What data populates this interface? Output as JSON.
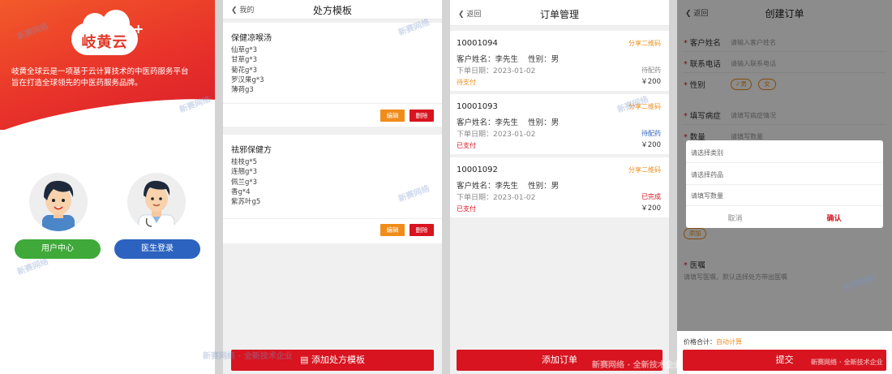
{
  "panel1": {
    "logo_text": "岐黄云",
    "logo_plus": "+",
    "desc_line1": "岐黄全球云是一项基于云计算技术的中医药服务平台",
    "desc_line2": "旨在打造全球领先的中医药服务品牌。",
    "user_center_label": "用户中心",
    "doctor_login_label": "医生登录",
    "colors": {
      "accent": "#e8322a",
      "green": "#3fa93a",
      "blue": "#2c63c0"
    }
  },
  "panel2": {
    "back_label": "我的",
    "title": "处方模板",
    "templates": [
      {
        "name": "保健凉喉汤",
        "herbs": [
          "仙草g*3",
          "甘草g*3",
          "菊花g*3",
          "罗汉果g*3",
          "薄荷g3"
        ],
        "edit": "编辑",
        "delete": "删除"
      },
      {
        "name": "祛邪保健方",
        "herbs": [
          "桂枝g*5",
          "连翘g*3",
          "佩兰g*3",
          "香g*4",
          "紫苏叶g5"
        ],
        "edit": "编辑",
        "delete": "删除"
      }
    ],
    "add_button": "添加处方模板"
  },
  "panel3": {
    "back_label": "返回",
    "title": "订单管理",
    "orders": [
      {
        "id": "10001094",
        "share": "分享二维码",
        "customer": "客户姓名：李先生",
        "gender": "性别：男",
        "date": "下单日期：2023-01-02",
        "status": "待配药",
        "paid": "待支付",
        "price": "￥200"
      },
      {
        "id": "10001093",
        "share": "分享二维码",
        "customer": "客户姓名：李先生",
        "gender": "性别：男",
        "date": "下单日期：2023-01-02",
        "status": "待配药",
        "paid": "已支付",
        "price": "￥200"
      },
      {
        "id": "10001092",
        "share": "分享二维码",
        "customer": "客户姓名：李先生",
        "gender": "性别：男",
        "date": "下单日期：2023-01-02",
        "status": "已完成",
        "paid": "已支付",
        "price": "￥200"
      }
    ],
    "add_button": "添加订单"
  },
  "panel4": {
    "back_label": "返回",
    "title": "创建订单",
    "fields": [
      {
        "label": "客户姓名",
        "placeholder": "请输入客户姓名"
      },
      {
        "label": "联系电话",
        "placeholder": "请输入联系电话"
      },
      {
        "label": "性别",
        "placeholder": ""
      },
      {
        "label": "填写病症",
        "placeholder": "请填写病症情况"
      },
      {
        "label": "数量",
        "placeholder": "请填写数量"
      }
    ],
    "gender_male": "男",
    "gender_female": "女",
    "add_tag": "添加",
    "advice_label": "医嘱",
    "advice_placeholder": "请填写医嘱，默认选择处方带出医嘱",
    "modal": {
      "category": "请选择类别",
      "drug": "请选择药品",
      "qty": "请填写数量",
      "cancel": "取消",
      "confirm": "确认"
    },
    "price_label": "价格合计：",
    "price_value": "自动计算",
    "submit": "提交"
  },
  "watermark": "新赛网络",
  "watermark2": "新赛网络 · 全新技术企业"
}
